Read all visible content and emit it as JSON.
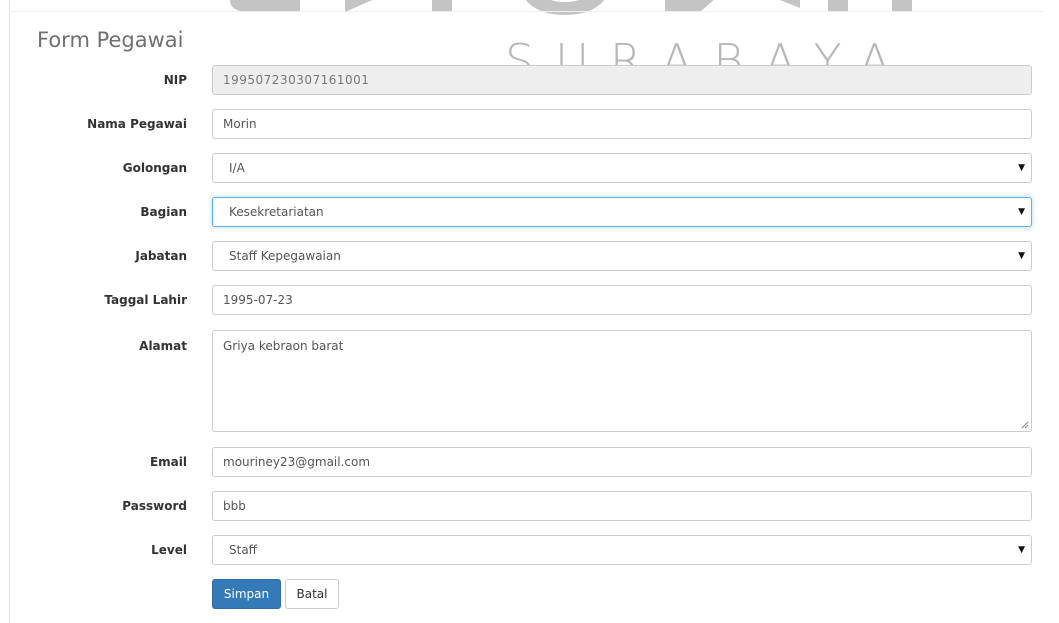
{
  "watermark": {
    "text": "SURABAYA"
  },
  "form": {
    "title": "Form Pegawai",
    "fields": {
      "nip": {
        "label": "NIP",
        "value": "199507230307161001"
      },
      "nama": {
        "label": "Nama Pegawai",
        "value": "Morin"
      },
      "golongan": {
        "label": "Golongan",
        "value": "I/A"
      },
      "bagian": {
        "label": "Bagian",
        "value": "Kesekretariatan"
      },
      "jabatan": {
        "label": "Jabatan",
        "value": "Staff Kepegawaian"
      },
      "tanggal": {
        "label": "Taggal Lahir",
        "value": "1995-07-23"
      },
      "alamat": {
        "label": "Alamat",
        "value": "Griya kebraon barat"
      },
      "email": {
        "label": "Email",
        "value": "mouriney23@gmail.com"
      },
      "password": {
        "label": "Password",
        "value": "bbb"
      },
      "level": {
        "label": "Level",
        "value": "Staff"
      }
    },
    "buttons": {
      "save": "Simpan",
      "cancel": "Batal"
    }
  },
  "colors": {
    "primary": "#337ab7",
    "focus_border": "#66afe9",
    "readonly_bg": "#eeeeee",
    "watermark": "#b7b7b7"
  },
  "icons": {
    "select_caret": "caret-down-icon",
    "textarea_grip": "resize-grip-icon"
  }
}
